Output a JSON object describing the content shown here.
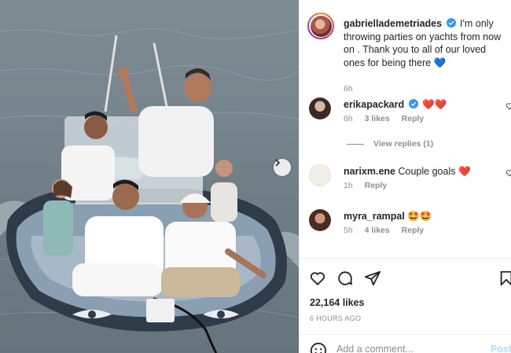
{
  "post": {
    "image_alt": "Group on an inflatable boat at sea",
    "caption": {
      "username": "gabriellademetriades",
      "text": "I'm only throwing parties on yachts from now on . Thank you to all of our loved ones for being there",
      "emoji": "💙",
      "time": "6h"
    },
    "comments": [
      {
        "username": "erikapackard",
        "text": "❤️❤️",
        "time": "6h",
        "likes": "3 likes",
        "reply": "Reply",
        "verified": true
      },
      {
        "username": "narixm.ene",
        "text": "Couple goals ❤️",
        "time": "1h",
        "likes": "",
        "reply": "Reply",
        "verified": false
      },
      {
        "username": "myra_rampal",
        "text": "🤩🤩",
        "time": "5h",
        "likes": "4 likes",
        "reply": "Reply",
        "verified": false
      }
    ],
    "view_replies": "View replies (1)",
    "likes_count": "22,164 likes",
    "posted_ago": "6 HOURS AGO",
    "add_comment_placeholder": "Add a comment...",
    "post_button": "Post"
  },
  "icons": {
    "heart": "heart-icon",
    "comment": "comment-icon",
    "share": "share-icon",
    "save": "bookmark-icon",
    "emoji": "emoji-icon",
    "next": "chevron-right-icon"
  },
  "colors": {
    "verified": "#3897f0",
    "text": "#262626",
    "muted": "#8e8e8e",
    "post_disabled": "#b2dffc"
  }
}
